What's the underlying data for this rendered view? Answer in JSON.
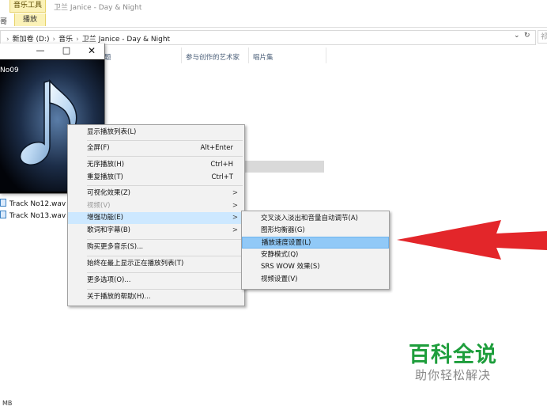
{
  "ribbon": {
    "context_tab": "音乐工具",
    "title": "卫兰 Janice - Day & Night",
    "left_tab_fragment": "哥",
    "play_tab": "播放"
  },
  "address_bar": {
    "crumbs": [
      "新加卷 (D:)",
      "音乐",
      "卫兰 Janice - Day & Night"
    ],
    "dropdown_icon": "chevron-down-icon",
    "refresh_icon": "refresh-icon",
    "search_fragment": "祁"
  },
  "columns": {
    "partial_header": "题",
    "contributing_artists": "参与创作的艺术家",
    "album": "唱片集"
  },
  "files": [
    {
      "name": "Track No12.wav"
    },
    {
      "name": "Track No13.wav"
    }
  ],
  "status_bar": {
    "size_fragment": "MB"
  },
  "player": {
    "track_label": "No09",
    "minimize": "—",
    "maximize": "□",
    "close": "✕"
  },
  "context_menu": {
    "items": [
      {
        "label": "显示播放列表(L)",
        "shortcut": "",
        "arrow": false,
        "disabled": false
      },
      {
        "label": "全屏(F)",
        "shortcut": "Alt+Enter",
        "arrow": false,
        "disabled": false
      },
      {
        "label": "无序播放(H)",
        "shortcut": "Ctrl+H",
        "arrow": false,
        "disabled": false
      },
      {
        "label": "重复播放(T)",
        "shortcut": "Ctrl+T",
        "arrow": false,
        "disabled": false
      },
      {
        "label": "可视化效果(Z)",
        "shortcut": "",
        "arrow": true,
        "disabled": false
      },
      {
        "label": "视频(V)",
        "shortcut": "",
        "arrow": true,
        "disabled": true
      },
      {
        "label": "增强功能(E)",
        "shortcut": "",
        "arrow": true,
        "disabled": false
      },
      {
        "label": "歌词和字幕(B)",
        "shortcut": "",
        "arrow": true,
        "disabled": false
      },
      {
        "label": "购买更多音乐(S)...",
        "shortcut": "",
        "arrow": false,
        "disabled": false
      },
      {
        "label": "始终在最上显示正在播放列表(T)",
        "shortcut": "",
        "arrow": false,
        "disabled": false
      },
      {
        "label": "更多选项(O)...",
        "shortcut": "",
        "arrow": false,
        "disabled": false
      },
      {
        "label": "关于播放的帮助(H)...",
        "shortcut": "",
        "arrow": false,
        "disabled": false
      }
    ],
    "arrow_glyph": ">"
  },
  "submenu": {
    "items": [
      {
        "label": "交叉淡入淡出和音量自动调节(A)"
      },
      {
        "label": "图形均衡器(G)"
      },
      {
        "label": "播放速度设置(L)"
      },
      {
        "label": "安静模式(Q)"
      },
      {
        "label": "SRS WOW 效果(S)"
      },
      {
        "label": "视频设置(V)"
      }
    ]
  },
  "watermark": {
    "title": "百科全说",
    "subtitle": "助你轻松解决"
  },
  "colors": {
    "menu_bg": "#f2f2f2",
    "menu_highlight": "#cde8ff",
    "submenu_highlight": "#91c9f7",
    "ribbon_context": "#fbf2b8",
    "arrow_red": "#e3262a",
    "watermark_green": "#1e9e3c"
  }
}
